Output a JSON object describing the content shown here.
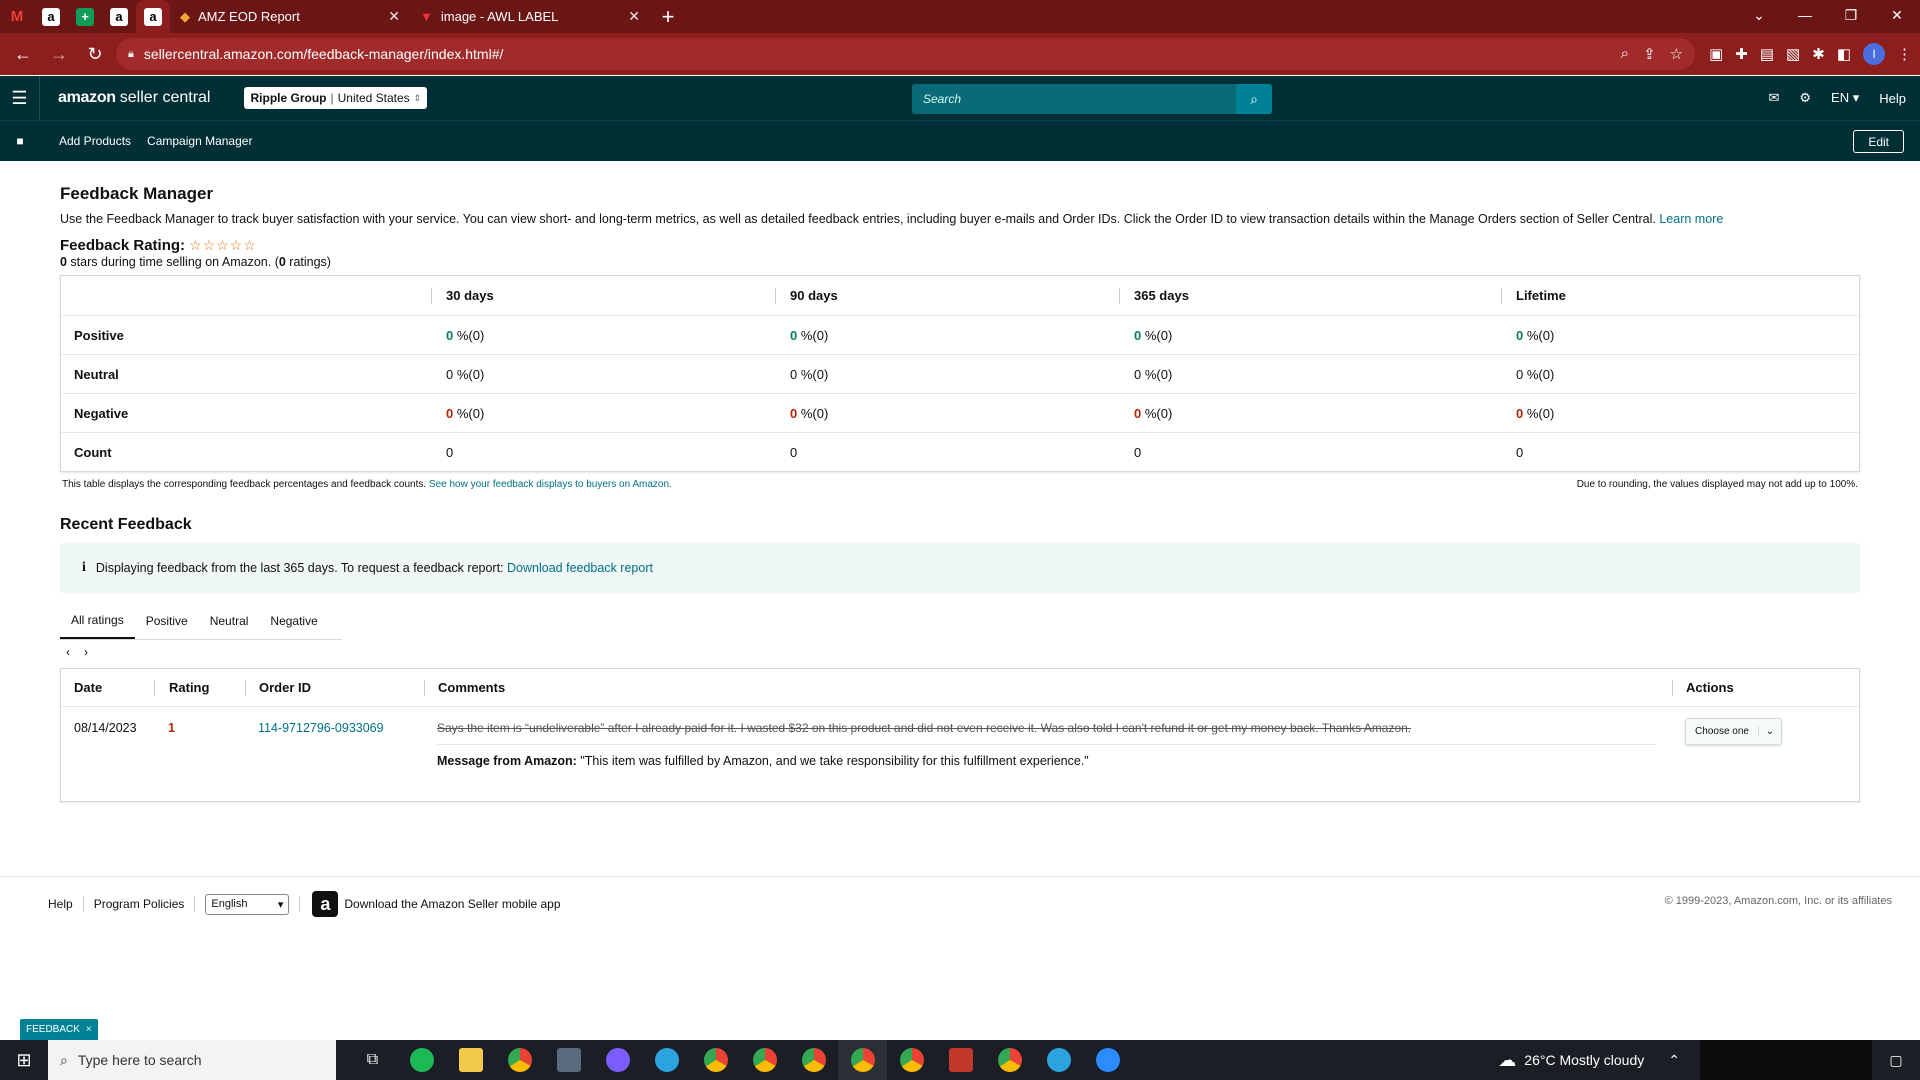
{
  "browser": {
    "tabs": [
      {
        "title": "AMZ EOD Report",
        "active": false
      },
      {
        "title": "image - AWL LABEL",
        "active": false
      }
    ],
    "pinned_tabs": [
      "gmail-icon",
      "amazon-icon",
      "sheets-icon",
      "amazon-icon",
      "amazon-icon"
    ],
    "url": "sellercentral.amazon.com/feedback-manager/index.html#/",
    "new_tab_label": "+",
    "profile_initial": "I"
  },
  "header": {
    "logo_brand": "amazon",
    "logo_suffix": "seller central",
    "account_name": "Ripple Group",
    "account_region": "United States",
    "search_placeholder": "Search",
    "language": "EN",
    "help": "Help"
  },
  "subnav": {
    "links": [
      "Add Products",
      "Campaign Manager"
    ],
    "edit": "Edit"
  },
  "page": {
    "title": "Feedback Manager",
    "intro": "Use the Feedback Manager to track buyer satisfaction with your service. You can view short- and long-term metrics, as well as detailed feedback entries, including buyer e-mails and Order IDs. Click the Order ID to view transaction details within the Manage Orders section of Seller Central.",
    "learn_more": "Learn more",
    "rating_label": "Feedback Rating:",
    "stars": "☆☆☆☆☆",
    "rating_stars": "0",
    "rating_sub_mid": " stars during time selling on Amazon. (",
    "rating_count": "0",
    "rating_sub_end": " ratings)"
  },
  "metrics": {
    "columns": [
      "30 days",
      "90 days",
      "365 days",
      "Lifetime"
    ],
    "rows": [
      {
        "label": "Positive",
        "values": [
          "0",
          "0",
          "0",
          "0"
        ],
        "counts": [
          "%(0)",
          "%(0)",
          "%(0)",
          "%(0)"
        ]
      },
      {
        "label": "Neutral",
        "values": [
          "0",
          "0",
          "0",
          "0"
        ],
        "counts": [
          "%(0)",
          "%(0)",
          "%(0)",
          "%(0)"
        ]
      },
      {
        "label": "Negative",
        "values": [
          "0",
          "0",
          "0",
          "0"
        ],
        "counts": [
          "%(0)",
          "%(0)",
          "%(0)",
          "%(0)"
        ]
      },
      {
        "label": "Count",
        "values": [
          "0",
          "0",
          "0",
          "0"
        ]
      }
    ],
    "note": "This table displays the corresponding feedback percentages and feedback counts.",
    "note_link": "See how your feedback displays to buyers on Amazon.",
    "rounding_note": "Due to rounding, the values displayed may not add up to 100%."
  },
  "recent": {
    "title": "Recent Feedback",
    "info_text": "Displaying feedback from the last 365 days. To request a feedback report:",
    "info_link": "Download feedback report",
    "tabs": [
      "All ratings",
      "Positive",
      "Neutral",
      "Negative"
    ],
    "columns": {
      "date": "Date",
      "rating": "Rating",
      "order": "Order ID",
      "comments": "Comments",
      "actions": "Actions"
    },
    "row": {
      "date": "08/14/2023",
      "rating": "1",
      "order_id": "114-9712796-0933069",
      "comment": "Says the item is “undeliverable” after I already paid for it. I wasted $32 on this product and did not even receive it. Was also told I can't refund it or get my money back. Thanks Amazon.",
      "message_label": "Message from Amazon:",
      "message": "\"This item was fulfilled by Amazon, and we take responsibility for this fulfillment experience.\"",
      "action": "Choose one"
    }
  },
  "footer": {
    "help": "Help",
    "policies": "Program Policies",
    "language": "English",
    "app": "Download the Amazon Seller mobile app",
    "copyright": "© 1999-2023, Amazon.com, Inc. or its affiliates"
  },
  "feedback_tag": "FEEDBACK",
  "taskbar": {
    "search_placeholder": "Type here to search",
    "weather": "26°C  Mostly cloudy",
    "apps": [
      "task-view",
      "spotify",
      "file-explorer",
      "chrome",
      "calculator",
      "messenger",
      "telegram",
      "chrome-profile",
      "chrome-profile",
      "chrome-profile",
      "chrome",
      "chrome-profile",
      "app",
      "chrome-profile",
      "telegram",
      "zoom"
    ],
    "colors": {
      "spotify": "#1db954",
      "chrome": "#e8b00c",
      "telegram": "#2aa3df",
      "messenger": "#7b5cff",
      "zoom": "#2d8cff",
      "explorer": "#f2c94c"
    }
  },
  "colors": {
    "header_bg": "#002f36",
    "link": "#007185",
    "positive": "#067d62",
    "negative": "#b12704",
    "browser_bg": "#8c1e1e"
  }
}
